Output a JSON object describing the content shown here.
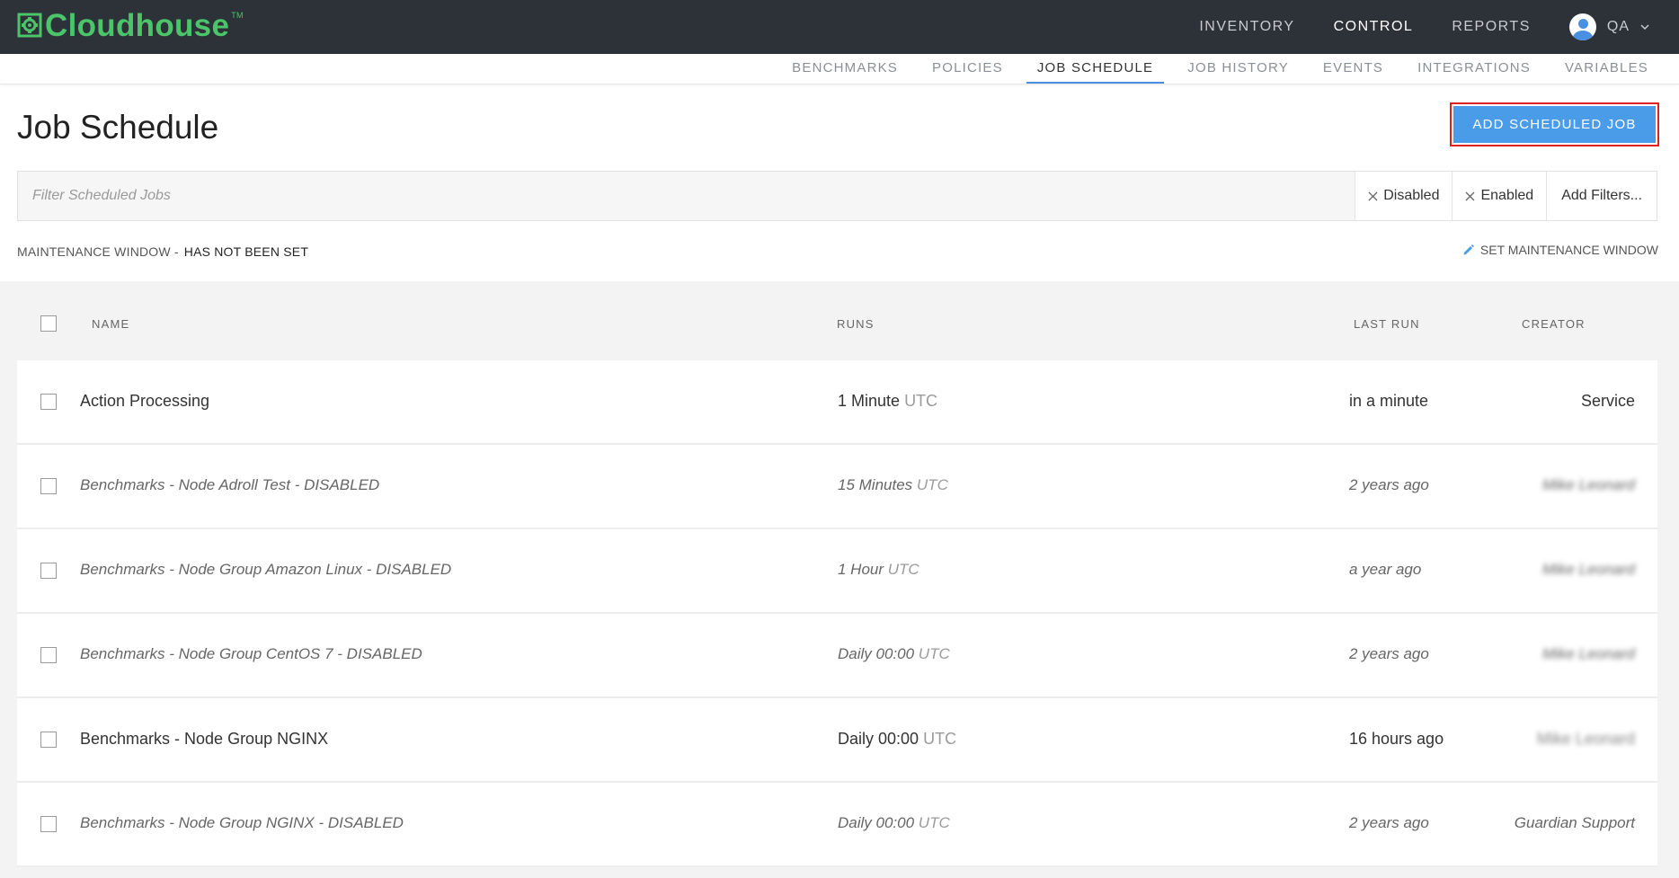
{
  "app": {
    "logo_text": "Cloudhouse",
    "trademark": "TM"
  },
  "top_nav": {
    "items": [
      {
        "label": "INVENTORY",
        "active": false
      },
      {
        "label": "CONTROL",
        "active": true
      },
      {
        "label": "REPORTS",
        "active": false
      }
    ],
    "user": "QA"
  },
  "sub_nav": {
    "tabs": [
      {
        "label": "BENCHMARKS",
        "active": false
      },
      {
        "label": "POLICIES",
        "active": false
      },
      {
        "label": "JOB SCHEDULE",
        "active": true
      },
      {
        "label": "JOB HISTORY",
        "active": false
      },
      {
        "label": "EVENTS",
        "active": false
      },
      {
        "label": "INTEGRATIONS",
        "active": false
      },
      {
        "label": "VARIABLES",
        "active": false
      }
    ]
  },
  "page": {
    "title": "Job Schedule",
    "add_button": "ADD SCHEDULED JOB"
  },
  "filter": {
    "placeholder": "Filter Scheduled Jobs",
    "chips": [
      "Disabled",
      "Enabled"
    ],
    "add_filters": "Add Filters..."
  },
  "maintenance": {
    "label": "MAINTENANCE WINDOW -",
    "value": "HAS NOT BEEN SET",
    "set_link": "SET MAINTENANCE WINDOW"
  },
  "table": {
    "headers": {
      "name": "NAME",
      "runs": "RUNS",
      "last_run": "LAST RUN",
      "creator": "CREATOR"
    },
    "rows": [
      {
        "name": "Action Processing",
        "runs": "1 Minute",
        "tz": "UTC",
        "last_run": "in a minute",
        "creator": "Service",
        "disabled": false,
        "creator_blurred": false
      },
      {
        "name": "Benchmarks - Node Adroll Test - DISABLED",
        "runs": "15 Minutes",
        "tz": "UTC",
        "last_run": "2 years ago",
        "creator": "Mike Leonard",
        "disabled": true,
        "creator_blurred": true
      },
      {
        "name": "Benchmarks - Node Group Amazon Linux - DISABLED",
        "runs": "1 Hour",
        "tz": "UTC",
        "last_run": "a year ago",
        "creator": "Mike Leonard",
        "disabled": true,
        "creator_blurred": true
      },
      {
        "name": "Benchmarks - Node Group CentOS 7 - DISABLED",
        "runs": "Daily 00:00",
        "tz": "UTC",
        "last_run": "2 years ago",
        "creator": "Mike Leonard",
        "disabled": true,
        "creator_blurred": true
      },
      {
        "name": "Benchmarks - Node Group NGINX",
        "runs": "Daily 00:00",
        "tz": "UTC",
        "last_run": "16 hours ago",
        "creator": "Mike Leonard",
        "disabled": false,
        "creator_blurred": true
      },
      {
        "name": "Benchmarks - Node Group NGINX - DISABLED",
        "runs": "Daily 00:00",
        "tz": "UTC",
        "last_run": "2 years ago",
        "creator": "Guardian Support",
        "disabled": true,
        "creator_blurred": false
      }
    ]
  },
  "colors": {
    "topbar": "#2d3138",
    "brand_green": "#4cc46a",
    "accent_blue": "#4a9be8",
    "highlight_red": "#e02020"
  }
}
